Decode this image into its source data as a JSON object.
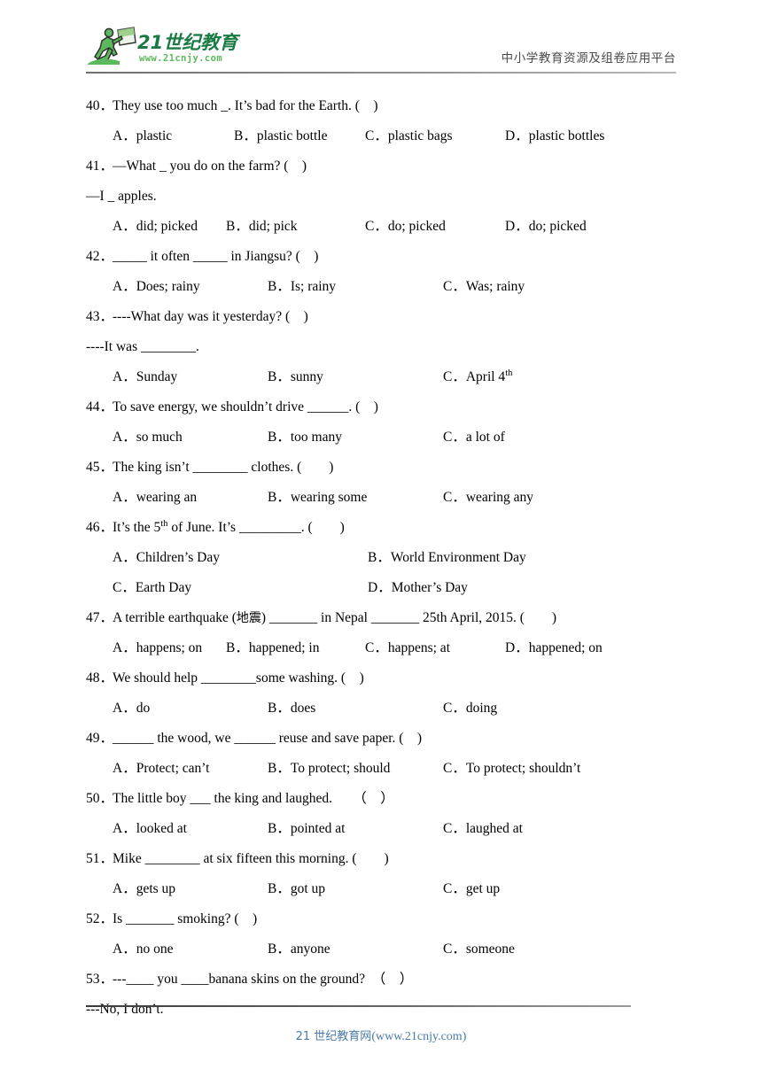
{
  "header": {
    "logo": {
      "brand_text": "21世纪教育",
      "brand_url": "www.21cnjy.com",
      "number": "21",
      "icon": "running-person-with-flag",
      "dark_green": "#1a7a44",
      "light_green": "#5cb85c"
    },
    "tagline": "中小学教育资源及组卷应用平台"
  },
  "footer": {
    "cn_text": "21 世纪教育网",
    "url_text": "(www.21cnjy.com)",
    "color": "#4a7ba7"
  },
  "questions": [
    {
      "number": "40．",
      "stem": "They use too much  _. It’s bad for the Earth. (　)",
      "layout": "four-wide",
      "options": [
        "A．plastic",
        "B．plastic bottle",
        "C．plastic bags",
        "D．plastic bottles"
      ]
    },
    {
      "number": "41．",
      "stem": "—What  _  you do on the farm? (　)",
      "continuation": "—I  _  apples.",
      "layout": "four-wide",
      "options": [
        "A．did; picked",
        "B．did; pick",
        "C．do; picked",
        "D．do; picked"
      ]
    },
    {
      "number": "42．",
      "stem": "_____ it often _____ in Jiangsu? (　)",
      "layout": "three",
      "options": [
        "A．Does; rainy",
        "B．Is; rainy",
        "C．Was; rainy"
      ]
    },
    {
      "number": "43．",
      "stem": "----What day was it yesterday? (　)",
      "continuation": "----It was ________.",
      "layout": "three",
      "options_rich": [
        {
          "label": "A．",
          "text": "Sunday"
        },
        {
          "label": "B．",
          "text": "sunny"
        },
        {
          "label": "C．",
          "text": "April 4",
          "sup": "th"
        }
      ]
    },
    {
      "number": "44．",
      "stem": "To save energy, we shouldn’t drive ______. (　)",
      "layout": "three",
      "options": [
        "A．so much",
        "B．too many",
        "C．a lot of"
      ]
    },
    {
      "number": "45．",
      "stem": "The king isn’t ________ clothes. (　　)",
      "layout": "three",
      "options": [
        "A．wearing an",
        "B．wearing some",
        "C．wearing any"
      ]
    },
    {
      "number": "46．",
      "stem_pre": "It’s the 5",
      "stem_sup": "th",
      "stem_post": " of June. It’s _________. (　　)",
      "layout": "two-column",
      "options": [
        "A．Children’s Day",
        "B．World Environment Day",
        "C．Earth Day",
        "D．Mother’s Day"
      ]
    },
    {
      "number": "47．",
      "stem_pre": "A terrible earthquake (",
      "stem_cn": "地震",
      "stem_post": ") _______ in Nepal _______ 25th April, 2015. (　　)",
      "layout": "four-tight",
      "options": [
        "A．happens; on",
        "B．happened; in",
        "C．happens; at",
        "D．happened; on"
      ]
    },
    {
      "number": "48．",
      "stem": "We should help ________some washing. (　)",
      "layout": "three",
      "options": [
        "A．do",
        "B．does",
        "C．doing"
      ]
    },
    {
      "number": "49．",
      "stem": "______ the wood, we ______ reuse and save paper. (　)",
      "layout": "three",
      "options": [
        "A．Protect; can’t",
        "B．To protect; should",
        "C．To protect; shouldn’t"
      ]
    },
    {
      "number": "50．",
      "stem": "The little boy ___ the king and laughed.　　（　）",
      "layout": "three",
      "options": [
        "A．looked at",
        "B．pointed at",
        "C．laughed at"
      ]
    },
    {
      "number": "51．",
      "stem": "Mike ________ at six fifteen this morning. (　　)",
      "layout": "three",
      "options": [
        "A．gets up",
        "B．got up",
        "C．get up"
      ]
    },
    {
      "number": "52．",
      "stem": "Is _______ smoking? (　)",
      "layout": "three",
      "options": [
        "A．no one",
        "B．anyone",
        "C．someone"
      ]
    },
    {
      "number": "53．",
      "stem": "---____ you ____banana skins on the ground?　（　）",
      "continuation": "---No, I don’t."
    }
  ]
}
